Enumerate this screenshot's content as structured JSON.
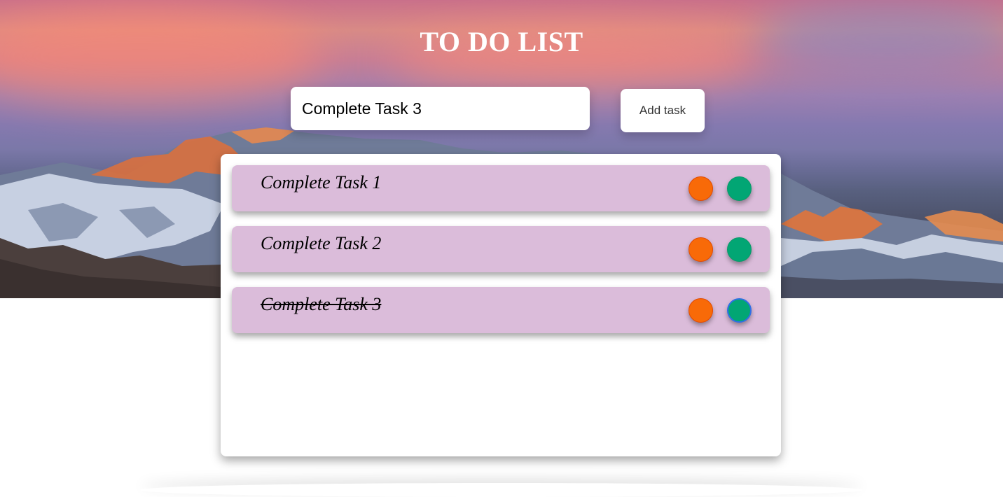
{
  "app": {
    "title": "TO DO LIST"
  },
  "form": {
    "input_value": "Complete Task 3",
    "add_label": "Add task"
  },
  "tasks": [
    {
      "text": "Complete Task 1",
      "completed": false
    },
    {
      "text": "Complete Task 2",
      "completed": false
    },
    {
      "text": "Complete Task 3",
      "completed": true
    }
  ],
  "icons": {
    "delete": "delete-circle-icon",
    "complete": "complete-circle-icon"
  },
  "colors": {
    "task_background": "#dbbcda",
    "delete_button": "#f86a08",
    "complete_button": "#02a674",
    "title_text": "#ffffff"
  }
}
